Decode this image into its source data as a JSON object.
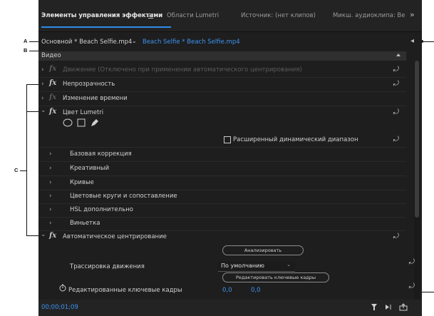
{
  "tabs": [
    {
      "label": "Элементы управления эффектами"
    },
    {
      "label": "Области Lumetri"
    },
    {
      "label": "Источник: (нет клипов)"
    },
    {
      "label": "Микш. аудиоклипа: Be"
    }
  ],
  "icons": {
    "menu": "hamburger-icon",
    "overflow": "double-chevron-right-icon",
    "collapse": "triangle-left-icon"
  },
  "clip": {
    "master": "Основной * Beach Selfie.mp4",
    "clip": "Beach Selfie * Beach Selfie.mp4"
  },
  "video_header": "Видео",
  "effects": {
    "motion": "Движение (Отключено при применении автоматического центрирования)",
    "opacity": "Непрозрачность",
    "time_remap": "Изменение времени",
    "lumetri": "Цвет Lumetri"
  },
  "hdr_label": "Расширенный динамический диапазон",
  "lumetri_sections": [
    "Базовая коррекция",
    "Креативный",
    "Кривые",
    "Цветовые круги и сопоставление",
    "HSL дополнительно",
    "Виньетка"
  ],
  "auto_reframe": {
    "label": "Автоматическое центрирование",
    "analyze_button": "Анализировать",
    "tracking_label": "Трассировка движения",
    "tracking_value": "По умолчанию",
    "edit_keyframes_button": "Редактировать ключевые кадры",
    "keyframes_label": "Редактированные ключевые кадры",
    "kf_x": "0,0",
    "kf_y": "0,0"
  },
  "glyphs": {
    "fx": "fx",
    "chevron_right": "›",
    "chevron_down": "⌄",
    "reset": "⤾",
    "dropdown": "⌄"
  },
  "timecode": "00;00;01;09",
  "callouts": {
    "a": "A",
    "b": "B",
    "c": "C"
  },
  "colors": {
    "accent": "#3d94f0",
    "panel": "#1e1e1e"
  }
}
